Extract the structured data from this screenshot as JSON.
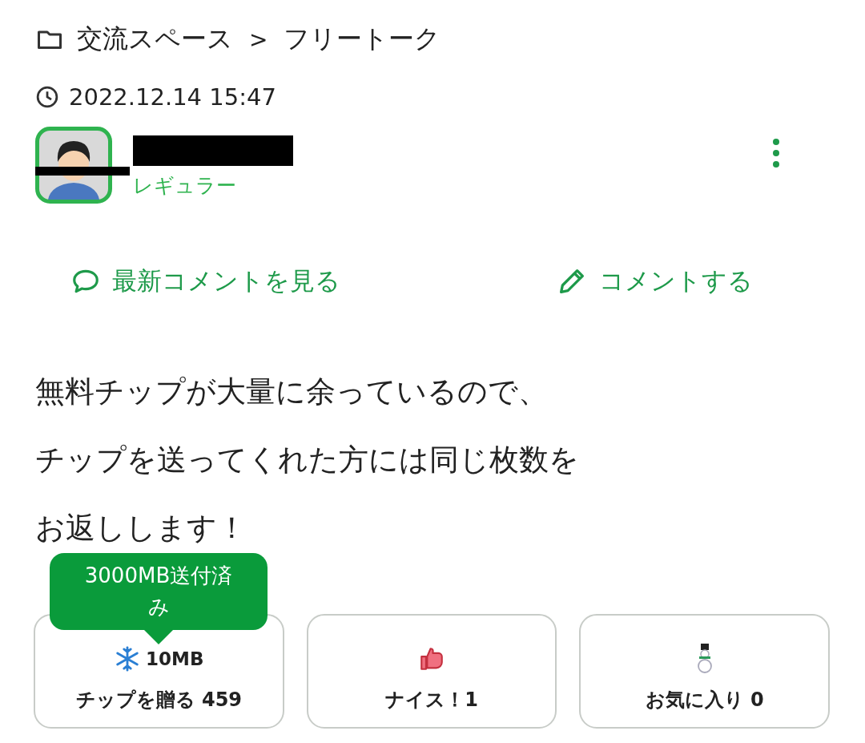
{
  "breadcrumb": {
    "items": [
      "交流スペース",
      "フリートーク"
    ],
    "separator": ">"
  },
  "timestamp": "2022.12.14 15:47",
  "author": {
    "role": "レギュラー"
  },
  "actions": [
    {
      "kind": "comments",
      "label": "最新コメントを見る"
    },
    {
      "kind": "write",
      "label": "コメントする"
    }
  ],
  "body": [
    "無料チップが大量に余っているので、",
    "チップを送ってくれた方には同じ枚数を",
    "お返しします！"
  ],
  "tooltip": "3000MB送付済み",
  "buttons": [
    {
      "kind": "tip",
      "amount": "10MB",
      "label": "チップを贈る 459"
    },
    {
      "kind": "nice",
      "label": "ナイス！1"
    },
    {
      "kind": "favorite",
      "label": "お気に入り 0"
    }
  ]
}
